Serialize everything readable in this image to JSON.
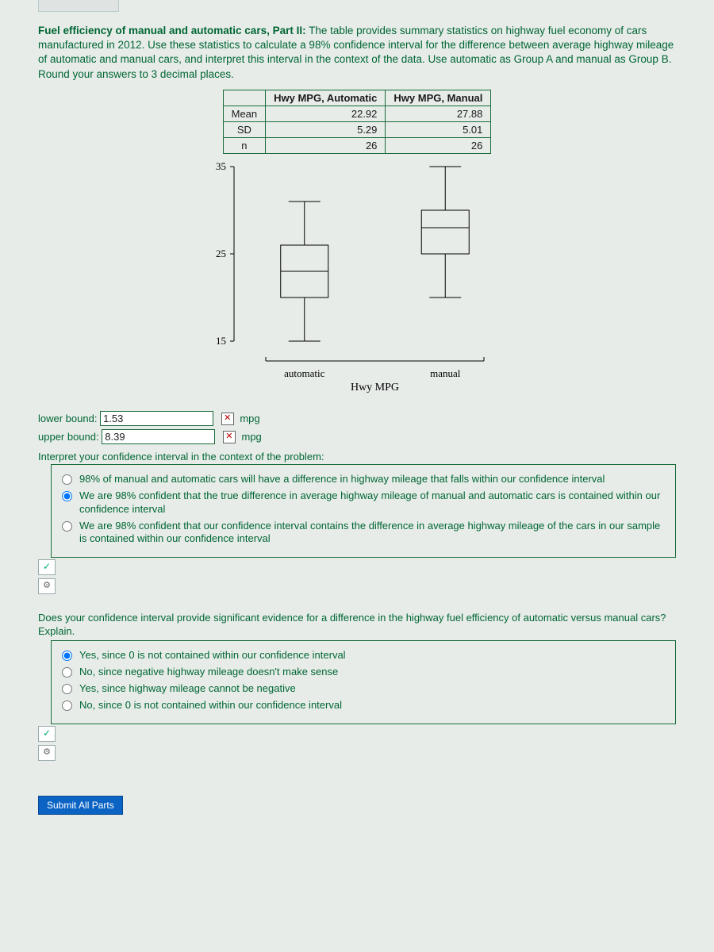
{
  "prompt": {
    "title": "Fuel efficiency of manual and automatic cars, Part II:",
    "body": "The table provides summary statistics on highway fuel economy of cars manufactured in 2012. Use these statistics to calculate a 98% confidence interval for the difference between average highway mileage of automatic and manual cars, and interpret this interval in the context of the data. Use automatic as Group A and manual as Group B. Round your answers to 3 decimal places."
  },
  "table": {
    "cols": [
      "Hwy MPG, Automatic",
      "Hwy MPG, Manual"
    ],
    "rows": [
      {
        "label": "Mean",
        "vals": [
          "22.92",
          "27.88"
        ]
      },
      {
        "label": "SD",
        "vals": [
          "5.29",
          "5.01"
        ]
      },
      {
        "label": "n",
        "vals": [
          "26",
          "26"
        ]
      }
    ]
  },
  "chart_data": {
    "type": "boxplot",
    "xlabel": "Hwy MPG",
    "categories": [
      "automatic",
      "manual"
    ],
    "ylim": [
      15,
      35
    ],
    "yticks": [
      15,
      25,
      35
    ],
    "boxes": [
      {
        "name": "automatic",
        "min": 15,
        "q1": 20,
        "median": 23,
        "q3": 26,
        "max": 31
      },
      {
        "name": "manual",
        "min": 20,
        "q1": 25,
        "median": 28,
        "q3": 30,
        "max": 35
      }
    ]
  },
  "answers": {
    "lower_label": "lower bound:",
    "lower_value": "1.53",
    "upper_label": "upper bound:",
    "upper_value": "8.39",
    "unit": "mpg",
    "wrong_glyph": "✕"
  },
  "interpret": {
    "heading": "Interpret your confidence interval in the context of the problem:",
    "options": [
      "98% of manual and automatic cars will have a difference in highway mileage that falls within our confidence interval",
      "We are 98% confident that the true difference in average highway mileage of manual and automatic cars is contained within our confidence interval",
      "We are 98% confident that our confidence interval contains the difference in average highway mileage of the cars in our sample is contained within our confidence interval"
    ],
    "selected": 1
  },
  "significance": {
    "heading": "Does your confidence interval provide significant evidence for a difference in the highway fuel efficiency of automatic versus manual cars? Explain.",
    "options": [
      "Yes, since 0 is not contained within our confidence interval",
      "No, since negative highway mileage doesn't make sense",
      "Yes, since highway mileage cannot be negative",
      "No, since 0 is not contained within our confidence interval"
    ],
    "selected": 0
  },
  "feedback": {
    "check": "✓",
    "gear": "⚙"
  },
  "submit_label": "Submit All Parts"
}
